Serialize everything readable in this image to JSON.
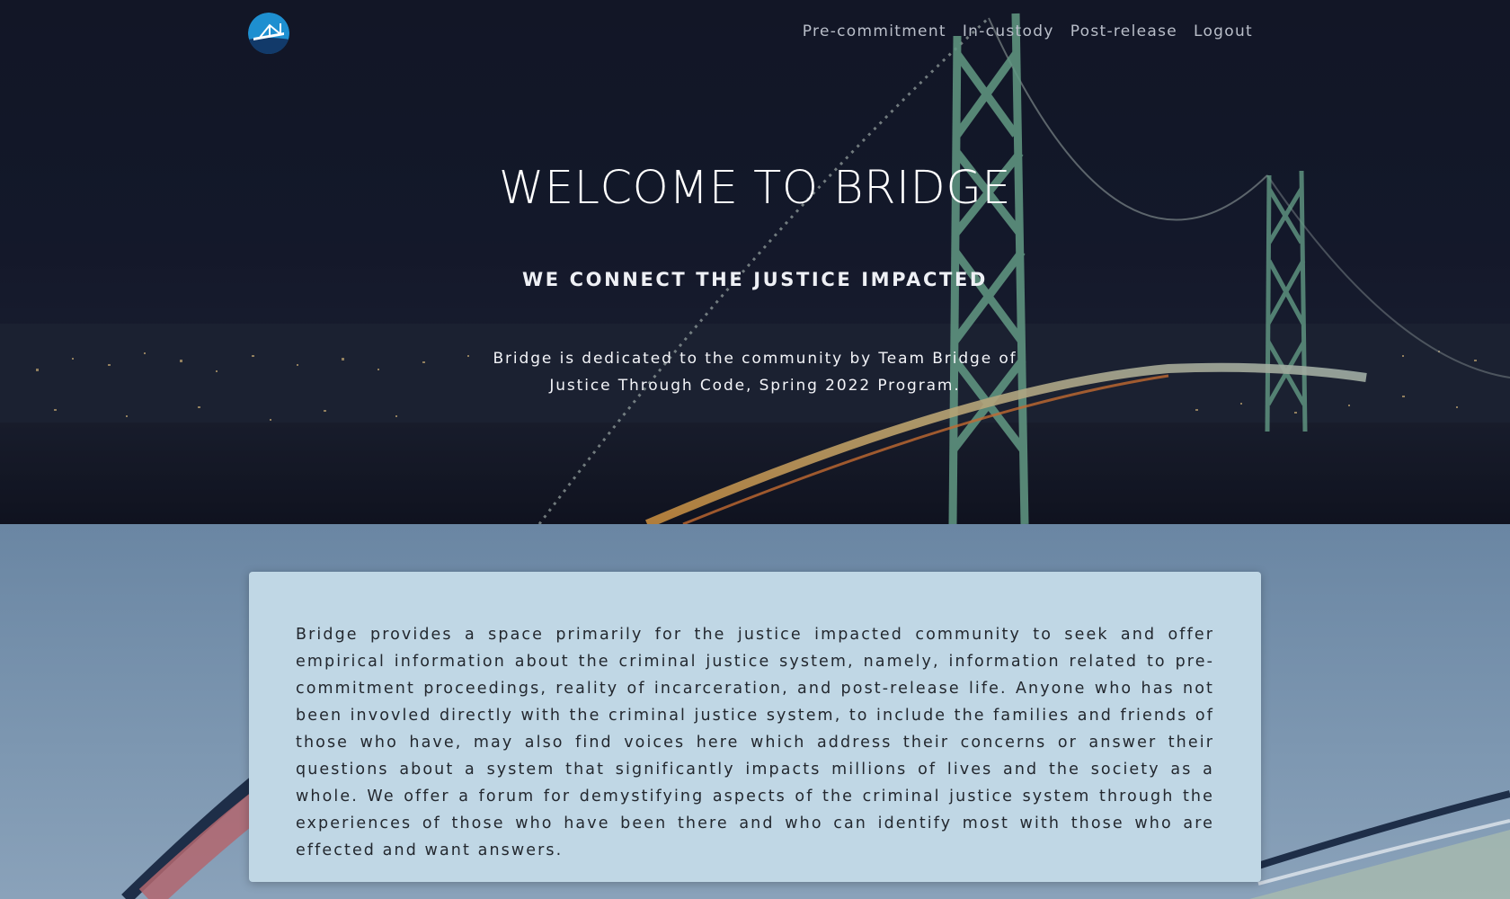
{
  "nav": {
    "logo_icon": "bridge-logo-icon",
    "links": [
      "Pre-commitment",
      "In-custody",
      "Post-release",
      "Logout"
    ]
  },
  "hero": {
    "title": "WELCOME TO BRIDGE",
    "subtitle": "WE CONNECT THE JUSTICE IMPACTED",
    "description": "Bridge is dedicated to the community by Team Bridge of Justice Through Code, Spring 2022 Program."
  },
  "about": {
    "text": "Bridge provides a space primarily for the justice impacted community to seek and offer empirical information about the criminal justice system, namely, information related to pre-commitment proceedings, reality of incarceration, and post-release life. Anyone who has not been invovled directly with the criminal justice system, to include the families and friends of those who have, may also find voices here which address their concerns or answer their questions about a system that significantly impacts millions of lives and the society as a whole. We offer a forum for demystifying aspects of the criminal justice system through the experiences of those who have been there and who can identify most with those who are effected and want answers."
  },
  "colors": {
    "logo_blue": "#1e8fd0",
    "bridge_green": "#7fc9a8",
    "card_bg": "#c0d7e5",
    "lower_bg": "#6e89a5"
  }
}
